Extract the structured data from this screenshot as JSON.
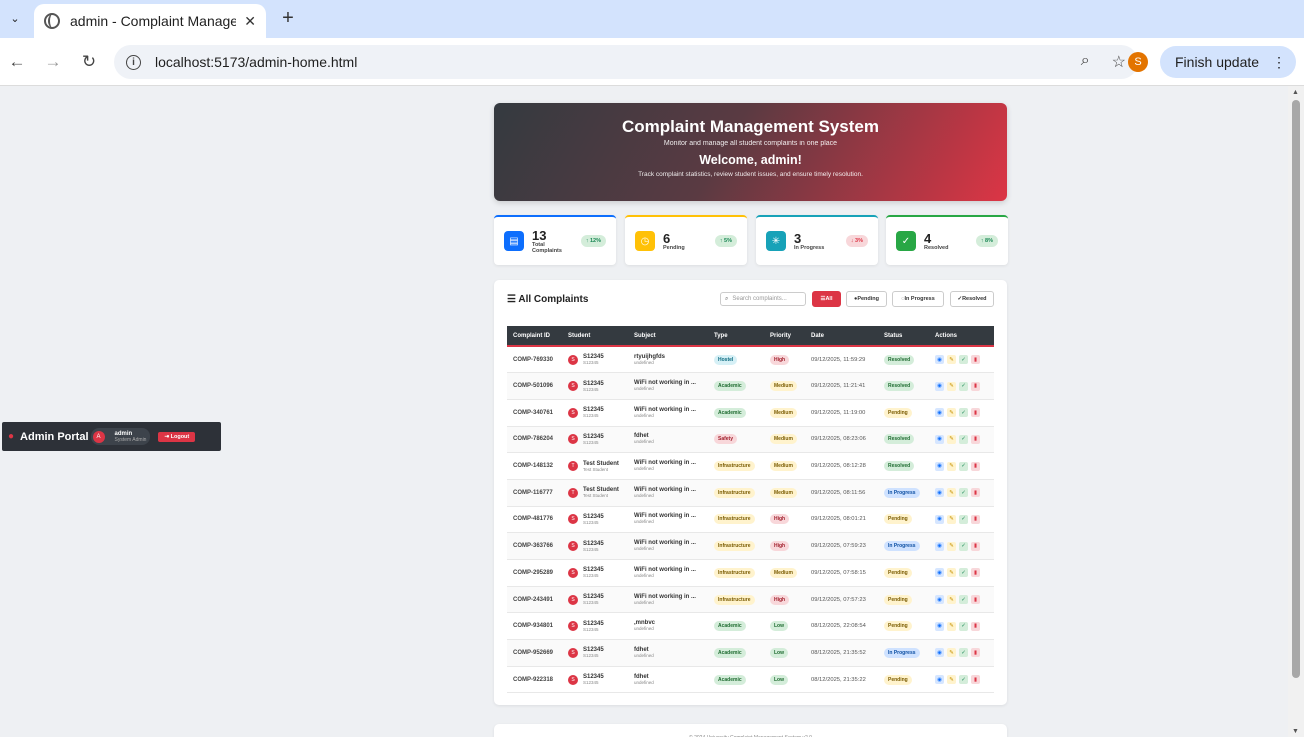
{
  "browser": {
    "tab_title": "admin - Complaint Management System",
    "url": "localhost:5173/admin-home.html",
    "profile_initial": "S",
    "finish_update": "Finish update"
  },
  "admin": {
    "portal_title": "Admin Portal",
    "avatar_initial": "A",
    "user_name": "admin",
    "user_role": "System Admin",
    "logout": "Logout"
  },
  "hero": {
    "title": "Complaint Management System",
    "subtitle": "Monitor and manage all student complaints in one place",
    "welcome": "Welcome, admin!",
    "description": "Track complaint statistics, review student issues, and ensure timely resolution."
  },
  "stats": [
    {
      "value": "13",
      "label": "Total Complaints",
      "trend": "↑ 12%",
      "color": "#0d6efd",
      "trend_color": "#198754",
      "trend_bg": "#d4edda",
      "icon": "file-icon"
    },
    {
      "value": "6",
      "label": "Pending",
      "trend": "↑ 5%",
      "color": "#ffc107",
      "trend_color": "#198754",
      "trend_bg": "#d4edda",
      "icon": "clock-icon"
    },
    {
      "value": "3",
      "label": "In Progress",
      "trend": "↓ 3%",
      "color": "#17a2b8",
      "trend_color": "#dc3545",
      "trend_bg": "#f8d7da",
      "icon": "spinner-icon"
    },
    {
      "value": "4",
      "label": "Resolved",
      "trend": "↑ 8%",
      "color": "#28a745",
      "trend_color": "#198754",
      "trend_bg": "#d4edda",
      "icon": "check-circle-icon"
    }
  ],
  "complaints": {
    "title": "All Complaints",
    "search_placeholder": "Search complaints...",
    "filters": {
      "all": "All",
      "pending": "Pending",
      "in_progress": "In Progress",
      "resolved": "Resolved"
    },
    "columns": [
      "Complaint ID",
      "Student",
      "Subject",
      "Type",
      "Priority",
      "Date",
      "Status",
      "Actions"
    ],
    "rows": [
      {
        "id": "COMP-769330",
        "avatar": "S",
        "student": "S12345",
        "student_id": "S12345",
        "subject": "rtyuijhgfds",
        "desc": "undefined",
        "type": "Hostel",
        "type_class": "t-hostel",
        "priority": "High",
        "priority_class": "p-high",
        "date": "09/12/2025, 11:59:29",
        "status": "Resolved",
        "status_class": "s-resolved"
      },
      {
        "id": "COMP-501096",
        "avatar": "S",
        "student": "S12345",
        "student_id": "S12345",
        "subject": "WiFi not working in ...",
        "desc": "undefined",
        "type": "Academic",
        "type_class": "t-academic",
        "priority": "Medium",
        "priority_class": "p-medium",
        "date": "09/12/2025, 11:21:41",
        "status": "Resolved",
        "status_class": "s-resolved"
      },
      {
        "id": "COMP-340761",
        "avatar": "S",
        "student": "S12345",
        "student_id": "S12345",
        "subject": "WiFi not working in ...",
        "desc": "undefined",
        "type": "Academic",
        "type_class": "t-academic",
        "priority": "Medium",
        "priority_class": "p-medium",
        "date": "09/12/2025, 11:19:00",
        "status": "Pending",
        "status_class": "s-pending"
      },
      {
        "id": "COMP-786204",
        "avatar": "S",
        "student": "S12345",
        "student_id": "S12345",
        "subject": "fdhet",
        "desc": "undefined",
        "type": "Safety",
        "type_class": "t-safety",
        "priority": "Medium",
        "priority_class": "p-medium",
        "date": "09/12/2025, 08:23:06",
        "status": "Resolved",
        "status_class": "s-resolved"
      },
      {
        "id": "COMP-148132",
        "avatar": "T",
        "student": "Test Student",
        "student_id": "Test Student",
        "subject": "WiFi not working in ...",
        "desc": "undefined",
        "type": "Infrastructure",
        "type_class": "t-infra",
        "priority": "Medium",
        "priority_class": "p-medium",
        "date": "09/12/2025, 08:12:28",
        "status": "Resolved",
        "status_class": "s-resolved"
      },
      {
        "id": "COMP-116777",
        "avatar": "T",
        "student": "Test Student",
        "student_id": "Test Student",
        "subject": "WiFi not working in ...",
        "desc": "undefined",
        "type": "Infrastructure",
        "type_class": "t-infra",
        "priority": "Medium",
        "priority_class": "p-medium",
        "date": "09/12/2025, 08:11:56",
        "status": "In Progress",
        "status_class": "s-progress"
      },
      {
        "id": "COMP-481776",
        "avatar": "S",
        "student": "S12345",
        "student_id": "S12345",
        "subject": "WiFi not working in ...",
        "desc": "undefined",
        "type": "Infrastructure",
        "type_class": "t-infra",
        "priority": "High",
        "priority_class": "p-high",
        "date": "09/12/2025, 08:01:21",
        "status": "Pending",
        "status_class": "s-pending"
      },
      {
        "id": "COMP-363766",
        "avatar": "S",
        "student": "S12345",
        "student_id": "S12345",
        "subject": "WiFi not working in ...",
        "desc": "undefined",
        "type": "Infrastructure",
        "type_class": "t-infra",
        "priority": "High",
        "priority_class": "p-high",
        "date": "09/12/2025, 07:59:23",
        "status": "In Progress",
        "status_class": "s-progress"
      },
      {
        "id": "COMP-295289",
        "avatar": "S",
        "student": "S12345",
        "student_id": "S12345",
        "subject": "WiFi not working in ...",
        "desc": "undefined",
        "type": "Infrastructure",
        "type_class": "t-infra",
        "priority": "Medium",
        "priority_class": "p-medium",
        "date": "09/12/2025, 07:58:15",
        "status": "Pending",
        "status_class": "s-pending"
      },
      {
        "id": "COMP-243491",
        "avatar": "S",
        "student": "S12345",
        "student_id": "S12345",
        "subject": "WiFi not working in ...",
        "desc": "undefined",
        "type": "Infrastructure",
        "type_class": "t-infra",
        "priority": "High",
        "priority_class": "p-high",
        "date": "09/12/2025, 07:57:23",
        "status": "Pending",
        "status_class": "s-pending"
      },
      {
        "id": "COMP-934801",
        "avatar": "S",
        "student": "S12345",
        "student_id": "S12345",
        "subject": ",mnbvc",
        "desc": "undefined",
        "type": "Academic",
        "type_class": "t-academic",
        "priority": "Low",
        "priority_class": "p-low",
        "date": "08/12/2025, 22:08:54",
        "status": "Pending",
        "status_class": "s-pending"
      },
      {
        "id": "COMP-952669",
        "avatar": "S",
        "student": "S12345",
        "student_id": "S12345",
        "subject": "fdhet",
        "desc": "undefined",
        "type": "Academic",
        "type_class": "t-academic",
        "priority": "Low",
        "priority_class": "p-low",
        "date": "08/12/2025, 21:35:52",
        "status": "In Progress",
        "status_class": "s-progress"
      },
      {
        "id": "COMP-922318",
        "avatar": "S",
        "student": "S12345",
        "student_id": "S12345",
        "subject": "fdhet",
        "desc": "undefined",
        "type": "Academic",
        "type_class": "t-academic",
        "priority": "Low",
        "priority_class": "p-low",
        "date": "08/12/2025, 21:35:22",
        "status": "Pending",
        "status_class": "s-pending"
      }
    ]
  },
  "footer": {
    "text": "© 2024 University Complaint Management System v2.0"
  }
}
